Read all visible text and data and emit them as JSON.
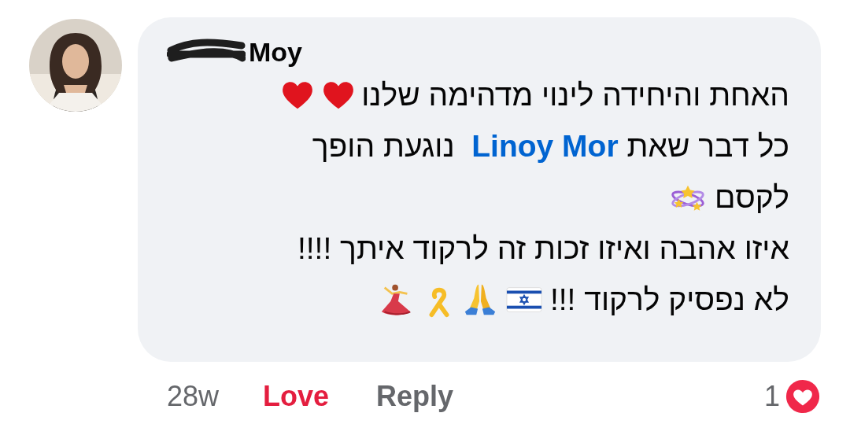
{
  "comment": {
    "author": "Moy",
    "author_redacted": true,
    "lines": [
      {
        "text": "האחת והיחידה לינוי מדהימה שלנו",
        "icons": [
          {
            "kind": "heart"
          },
          {
            "kind": "heart"
          }
        ]
      },
      {
        "before": "כל דבר שאת ",
        "link": "Linoy Mor",
        "after": "  נוגעת הופך"
      },
      {
        "text": "לקסם",
        "icons": [
          {
            "kind": "sparkles"
          }
        ]
      },
      {
        "text": "איזו אהבה ואיזו זכות זה לרקוד איתך !!!!"
      },
      {
        "text": "לא נפסיק לרקוד !!!",
        "icons": [
          {
            "kind": "flag"
          },
          {
            "kind": "pray"
          },
          {
            "kind": "ribbon"
          },
          {
            "kind": "dancer"
          }
        ]
      }
    ]
  },
  "footer": {
    "time": "28w",
    "love": {
      "label": "Love",
      "selected": true
    },
    "reply": "Reply",
    "reaction_count": "1"
  }
}
